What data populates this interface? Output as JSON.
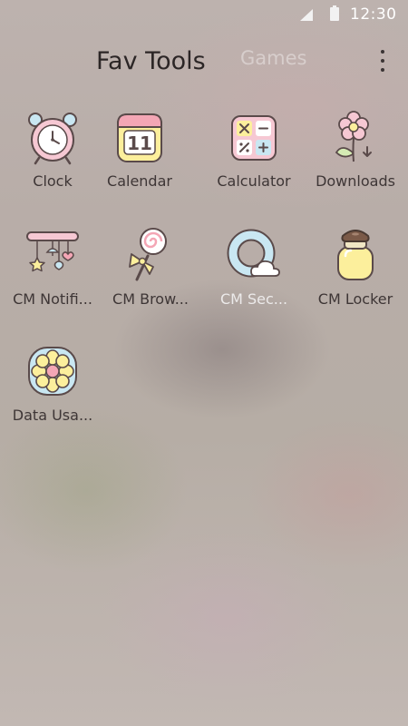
{
  "status_bar": {
    "time": "12:30",
    "signal_icon": "signal-icon",
    "battery_icon": "battery-icon"
  },
  "header": {
    "active_tab": "Fav Tools",
    "inactive_tab": "Games",
    "menu_icon": "overflow-menu-icon"
  },
  "apps": [
    {
      "label": "Clock",
      "icon": "clock-icon"
    },
    {
      "label": "Calendar",
      "icon": "calendar-icon",
      "icon_text": "11"
    },
    {
      "label": "Calculator",
      "icon": "calculator-icon"
    },
    {
      "label": "Downloads",
      "icon": "flower-icon"
    },
    {
      "label": "CM Notifi...",
      "icon": "mobile-icon"
    },
    {
      "label": "CM Brow...",
      "icon": "lollipop-icon"
    },
    {
      "label": "CM Sec...",
      "icon": "cloud-ring-icon"
    },
    {
      "label": "CM Locker",
      "icon": "jar-icon"
    },
    {
      "label": "Data Usa...",
      "icon": "daisy-icon"
    }
  ],
  "colors": {
    "accent_pink": "#f4b6c6",
    "accent_yellow": "#fcef9c",
    "accent_blue": "#c9e7f2",
    "outline": "#5a4a4a"
  }
}
